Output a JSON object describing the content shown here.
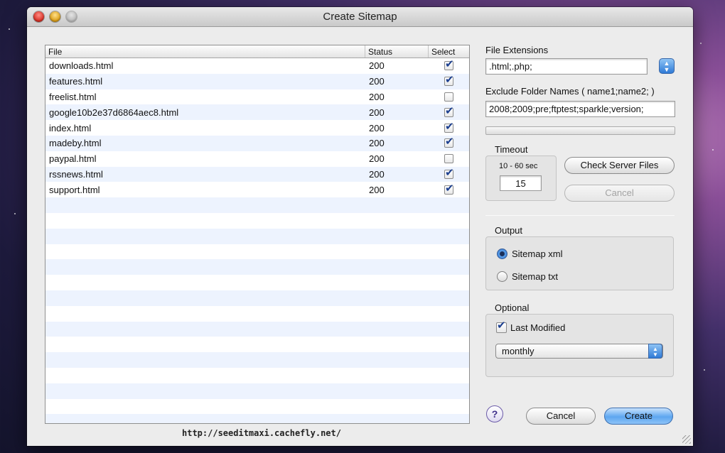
{
  "window": {
    "title": "Create Sitemap"
  },
  "table": {
    "headers": {
      "file": "File",
      "status": "Status",
      "select": "Select"
    },
    "rows": [
      {
        "file": "downloads.html",
        "status": "200",
        "checked": true
      },
      {
        "file": "features.html",
        "status": "200",
        "checked": true
      },
      {
        "file": "freelist.html",
        "status": "200",
        "checked": false
      },
      {
        "file": "google10b2e37d6864aec8.html",
        "status": "200",
        "checked": true
      },
      {
        "file": "index.html",
        "status": "200",
        "checked": true
      },
      {
        "file": "madeby.html",
        "status": "200",
        "checked": true
      },
      {
        "file": "paypal.html",
        "status": "200",
        "checked": false
      },
      {
        "file": "rssnews.html",
        "status": "200",
        "checked": true
      },
      {
        "file": "support.html",
        "status": "200",
        "checked": true
      }
    ]
  },
  "footer": {
    "url": "http://seeditmaxi.cachefly.net/"
  },
  "extensions": {
    "label": "File Extensions",
    "value": ".html;.php;"
  },
  "exclude": {
    "label": "Exclude Folder Names ( name1;name2; )",
    "value": "2008;2009;pre;ftptest;sparkle;version;"
  },
  "timeout": {
    "label": "Timeout",
    "range": "10 - 60 sec",
    "value": "15"
  },
  "buttons": {
    "check": "Check Server Files",
    "cancel_check": "Cancel",
    "cancel": "Cancel",
    "create": "Create"
  },
  "output": {
    "label": "Output",
    "options": [
      {
        "label": "Sitemap xml",
        "selected": true
      },
      {
        "label": "Sitemap txt",
        "selected": false
      }
    ]
  },
  "optional": {
    "label": "Optional",
    "last_modified_label": "Last Modified",
    "last_modified_checked": true,
    "frequency": "monthly"
  },
  "help": {
    "symbol": "?"
  },
  "colors": {
    "accent": "#2f7ad6",
    "row_stripe": "#edf3fe",
    "check": "#1c3f8f"
  }
}
